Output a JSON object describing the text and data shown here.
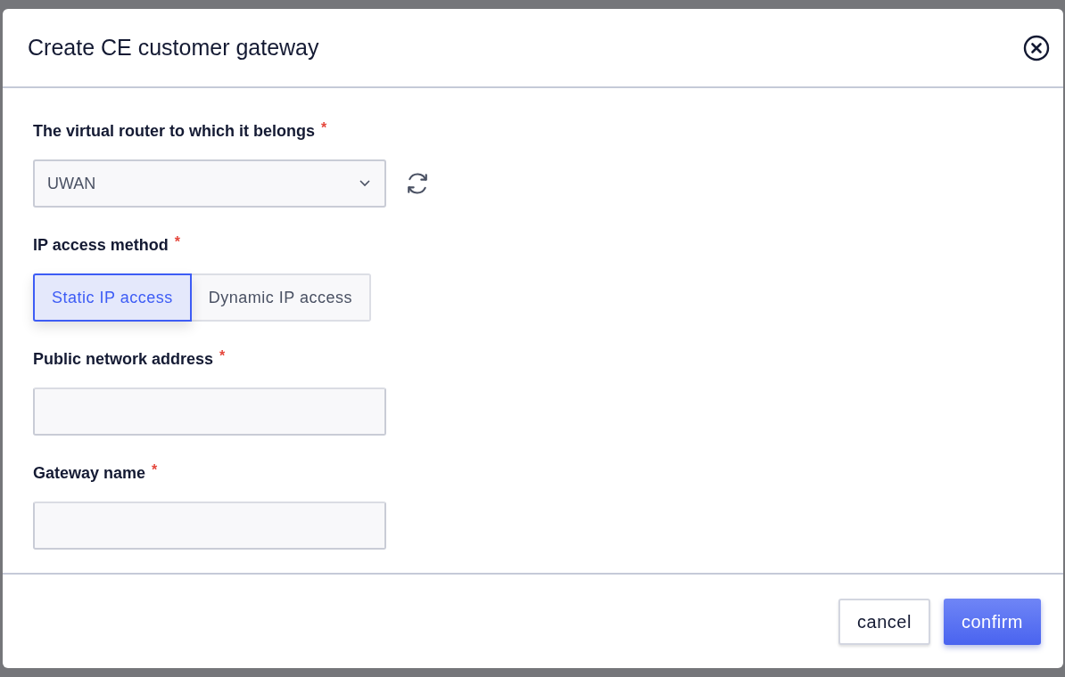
{
  "dialog": {
    "title": "Create CE customer gateway"
  },
  "fields": [
    {
      "kind": "select",
      "label": "The virtual router to which it belongs",
      "required_mark": "*",
      "value": "UWAN"
    },
    {
      "kind": "segmented",
      "label": "IP access method",
      "required_mark": "*",
      "options": [
        {
          "label": "Static IP access",
          "selected": true
        },
        {
          "label": "Dynamic IP access",
          "selected": false
        }
      ]
    },
    {
      "kind": "text",
      "label": "Public network address",
      "required_mark": "*"
    },
    {
      "kind": "text",
      "label": "Gateway name",
      "required_mark": "*"
    }
  ],
  "buttons": [
    {
      "label": "cancel",
      "kind": "secondary"
    },
    {
      "label": "confirm",
      "kind": "primary"
    }
  ]
}
